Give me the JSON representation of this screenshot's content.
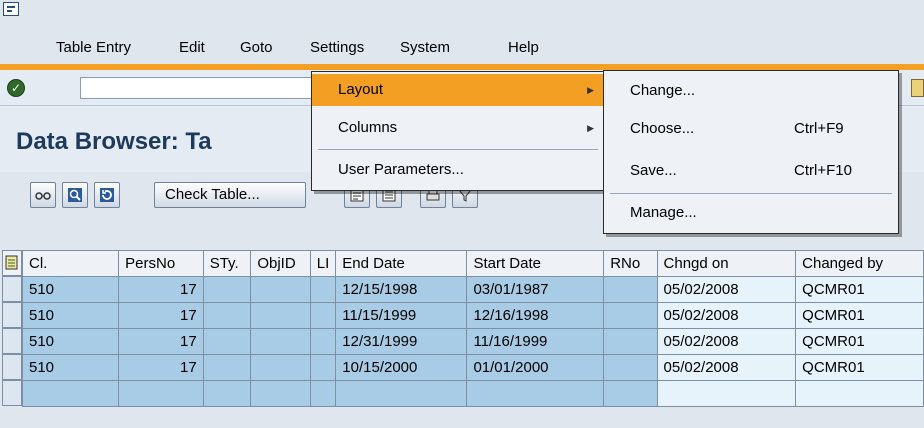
{
  "menubar": {
    "items": [
      {
        "label": "Table Entry"
      },
      {
        "label": "Edit"
      },
      {
        "label": "Goto"
      },
      {
        "label": "Settings"
      },
      {
        "label": "System"
      },
      {
        "label": "Help"
      }
    ]
  },
  "title": "Data Browser: Ta",
  "toolbar": {
    "check_table_label": "Check Table...",
    "command_field_value": ""
  },
  "settings_menu": {
    "items": [
      {
        "label": "Layout",
        "highlighted": true,
        "has_submenu": true
      },
      {
        "label": "Columns",
        "has_submenu": true
      },
      {
        "label": "User Parameters..."
      }
    ]
  },
  "layout_submenu": {
    "items": [
      {
        "label": "Change...",
        "shortcut": ""
      },
      {
        "label": "Choose...",
        "shortcut": "Ctrl+F9"
      },
      {
        "label": "Save...",
        "shortcut": "Ctrl+F10"
      },
      {
        "label": "Manage...",
        "shortcut": ""
      }
    ]
  },
  "table": {
    "columns": [
      "Cl.",
      "PersNo",
      "STy.",
      "ObjID",
      "LI",
      "End Date",
      "Start Date",
      "RNo",
      "Chngd on",
      "Changed by"
    ],
    "rows": [
      [
        "510",
        "17",
        "",
        "",
        "",
        "12/15/1998",
        "03/01/1987",
        "",
        "05/02/2008",
        "QCMR01"
      ],
      [
        "510",
        "17",
        "",
        "",
        "",
        "11/15/1999",
        "12/16/1998",
        "",
        "05/02/2008",
        "QCMR01"
      ],
      [
        "510",
        "17",
        "",
        "",
        "",
        "12/31/1999",
        "11/16/1999",
        "",
        "05/02/2008",
        "QCMR01"
      ],
      [
        "510",
        "17",
        "",
        "",
        "",
        "10/15/2000",
        "01/01/2000",
        "",
        "05/02/2008",
        "QCMR01"
      ]
    ]
  },
  "colors": {
    "accent_orange": "#f39f24",
    "title_blue": "#1d3a5c",
    "row_blue": "#a9cce6",
    "row_light": "#e6f3fb"
  },
  "icons": [
    "system-menu-icon",
    "ok-checkmark-icon",
    "select-all-icon"
  ]
}
